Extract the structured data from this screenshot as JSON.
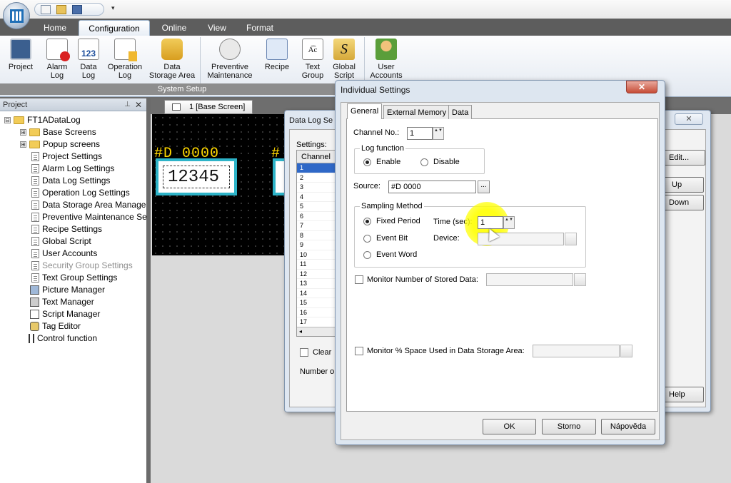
{
  "quick_access": {
    "dropdown": "▾"
  },
  "ribbon": {
    "tabs": [
      "Home",
      "Configuration",
      "Online",
      "View",
      "Format"
    ],
    "active_tab": "Configuration",
    "buttons": [
      {
        "line1": "Project",
        "line2": ""
      },
      {
        "line1": "Alarm",
        "line2": "Log"
      },
      {
        "line1": "Data",
        "line2": "Log"
      },
      {
        "line1": "Operation",
        "line2": "Log"
      },
      {
        "line1": "Data",
        "line2": "Storage Area"
      },
      {
        "line1": "Preventive",
        "line2": "Maintenance"
      },
      {
        "line1": "Recipe",
        "line2": ""
      },
      {
        "line1": "Text",
        "line2": "Group"
      },
      {
        "line1": "Global",
        "line2": "Script"
      },
      {
        "line1": "User",
        "line2": "Accounts"
      }
    ],
    "group_label": "System Setup",
    "icon_glyphs": {
      "data_log": "123",
      "text_group": "A͡c",
      "global_script": "S"
    }
  },
  "project_panel": {
    "title": "Project",
    "pin": "⊥",
    "close": "✕",
    "tree": [
      {
        "label": "FT1ADataLog",
        "level": 0,
        "icon": "folder",
        "expander": "⊟"
      },
      {
        "label": "Base Screens",
        "level": 1,
        "icon": "folder",
        "expander": "⊞"
      },
      {
        "label": "Popup screens",
        "level": 1,
        "icon": "folder",
        "expander": "⊞"
      },
      {
        "label": "Project Settings",
        "level": 1,
        "icon": "doc"
      },
      {
        "label": "Alarm Log Settings",
        "level": 1,
        "icon": "doc"
      },
      {
        "label": "Data Log Settings",
        "level": 1,
        "icon": "doc"
      },
      {
        "label": "Operation Log Settings",
        "level": 1,
        "icon": "doc"
      },
      {
        "label": "Data Storage Area Manage",
        "level": 1,
        "icon": "doc"
      },
      {
        "label": "Preventive Maintenance Se",
        "level": 1,
        "icon": "doc"
      },
      {
        "label": "Recipe Settings",
        "level": 1,
        "icon": "doc"
      },
      {
        "label": "Global Script",
        "level": 1,
        "icon": "doc"
      },
      {
        "label": "User Accounts",
        "level": 1,
        "icon": "doc"
      },
      {
        "label": "Security Group Settings",
        "level": 1,
        "icon": "doc",
        "disabled": true
      },
      {
        "label": "Text Group Settings",
        "level": 1,
        "icon": "doc"
      },
      {
        "label": "Picture Manager",
        "level": 1,
        "icon": "picture"
      },
      {
        "label": "Text Manager",
        "level": 1,
        "icon": "text"
      },
      {
        "label": "Script Manager",
        "level": 1,
        "icon": "script"
      },
      {
        "label": "Tag Editor",
        "level": 1,
        "icon": "tag"
      },
      {
        "label": "Control function",
        "level": 1,
        "icon": "control"
      }
    ]
  },
  "editor": {
    "screen_tab": "1  [Base Screen]",
    "tag_label": "#D 0000",
    "tag_value": "12345",
    "tag_label2": "#"
  },
  "data_log_settings": {
    "title": "Data Log Se",
    "close": "✕",
    "settings_label": "Settings:",
    "grid_header": "Channel",
    "rows": [
      "1",
      "2",
      "3",
      "4",
      "5",
      "6",
      "7",
      "8",
      "9",
      "10",
      "11",
      "12",
      "13",
      "14",
      "15",
      "16",
      "17"
    ],
    "scroll_left": "◂",
    "clear_label": "Clear",
    "number_label": "Number o",
    "buttons": {
      "edit": "Edit...",
      "up": "Up",
      "down": "Down",
      "help": "Help"
    }
  },
  "individual_settings": {
    "title": "Individual Settings",
    "close": "✕",
    "tabs": [
      "General",
      "External Memory",
      "Data"
    ],
    "channel_label": "Channel No.:",
    "channel_value": "1",
    "log_function": {
      "title": "Log function",
      "enable": "Enable",
      "disable": "Disable",
      "selected": "Enable"
    },
    "source_label": "Source:",
    "source_value": "#D 0000",
    "browse": "...",
    "sampling": {
      "title": "Sampling Method",
      "fixed_period": "Fixed Period",
      "event_bit": "Event Bit",
      "event_word": "Event Word",
      "selected": "Fixed Period",
      "time_label": "Time (sec):",
      "time_value": "1",
      "device_label": "Device:"
    },
    "monitor_stored": "Monitor Number of Stored Data:",
    "monitor_space": "Monitor % Space Used in Data Storage Area:",
    "buttons": {
      "ok": "OK",
      "cancel": "Storno",
      "help": "Nápověda"
    },
    "spin": "▲▼"
  }
}
